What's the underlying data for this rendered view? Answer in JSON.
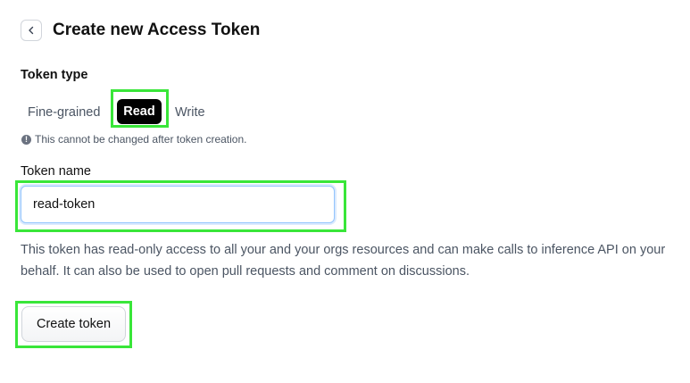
{
  "header": {
    "back_icon": "chevron-left-icon",
    "title": "Create new Access Token"
  },
  "token_type": {
    "label": "Token type",
    "options": [
      "Fine-grained",
      "Read",
      "Write"
    ],
    "selected": "Read",
    "note_icon": "info-icon",
    "note": "This cannot be changed after token creation."
  },
  "token_name": {
    "label": "Token name",
    "value": "read-token",
    "placeholder": ""
  },
  "description": "This token has read-only access to all your and your orgs resources and can make calls to inference API on your behalf. It can also be used to open pull requests and comment on discussions.",
  "actions": {
    "create_label": "Create token"
  },
  "colors": {
    "highlight": "#39e639",
    "selected_bg": "#000000",
    "input_focus": "#93c5fd"
  }
}
